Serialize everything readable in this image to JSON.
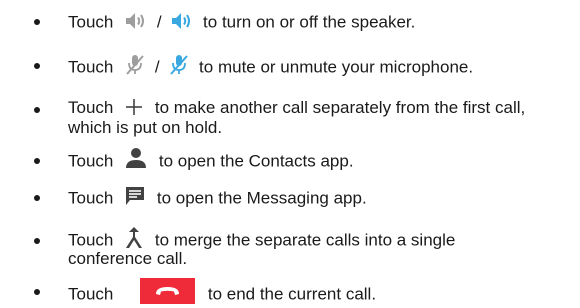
{
  "colors": {
    "text": "#1a1a1a",
    "icon_gray": "#9e9e9e",
    "icon_blue": "#3aa8e0",
    "icon_dark": "#424242",
    "end_call_red": "#ef2b39"
  },
  "items": [
    {
      "touch": "Touch",
      "icons": [
        "speaker-off-icon",
        "speaker-on-icon"
      ],
      "separator": "/",
      "text": "to turn on or off the speaker."
    },
    {
      "touch": "Touch",
      "icons": [
        "mic-muted-gray-icon",
        "mic-muted-blue-icon"
      ],
      "separator": "/",
      "text": "to mute or unmute your microphone."
    },
    {
      "touch": "Touch",
      "icons": [
        "plus-icon"
      ],
      "text": "to make another call separately from the first call,",
      "text2": "which is put on hold."
    },
    {
      "touch": "Touch",
      "icons": [
        "person-icon"
      ],
      "text": "to open the Contacts app."
    },
    {
      "touch": "Touch",
      "icons": [
        "message-icon"
      ],
      "text": "to open the Messaging app."
    },
    {
      "touch": "Touch",
      "icons": [
        "merge-icon"
      ],
      "text": "to merge the separate calls into a single",
      "text2": "conference call."
    },
    {
      "touch": "Touch",
      "icons": [
        "end-call-icon"
      ],
      "text": "to end the current call."
    }
  ]
}
